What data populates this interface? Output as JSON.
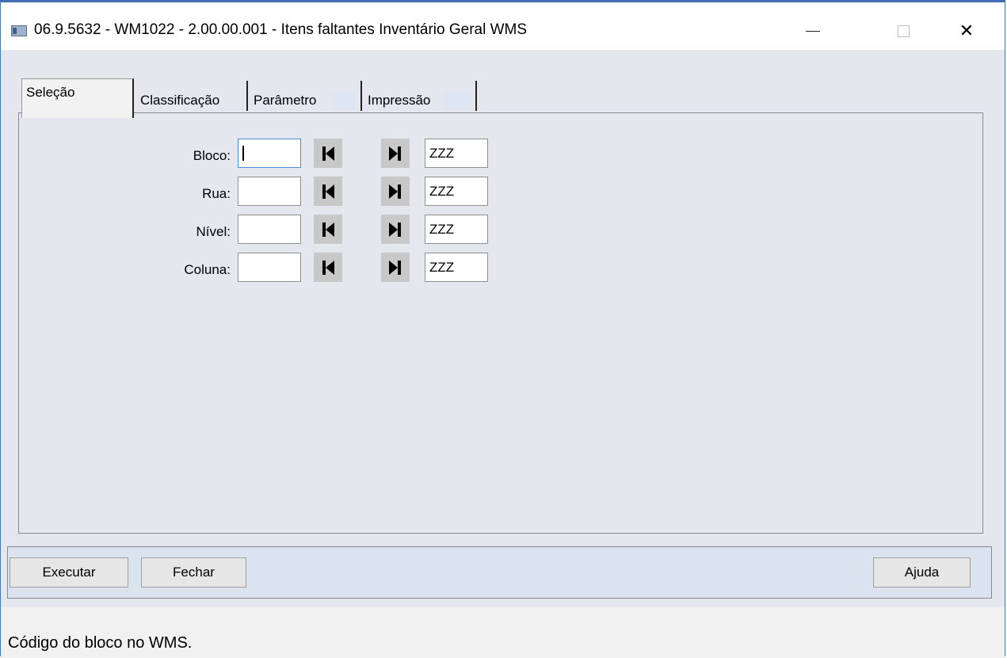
{
  "window": {
    "title": "06.9.5632 - WM1022 - 2.00.00.001 - Itens faltantes Inventário Geral WMS",
    "minimize_glyph": "—",
    "close_glyph": "✕"
  },
  "tabs": [
    {
      "label": "Seleção",
      "active": true
    },
    {
      "label": "Classificação",
      "active": false
    },
    {
      "label": "Parâmetro",
      "active": false
    },
    {
      "label": "Impressão",
      "active": false
    }
  ],
  "ranges": [
    {
      "label": "Bloco:",
      "from": "",
      "to": "ZZZ",
      "focused": true
    },
    {
      "label": "Rua:",
      "from": "",
      "to": "ZZZ",
      "focused": false
    },
    {
      "label": "Nível:",
      "from": "",
      "to": "ZZZ",
      "focused": false
    },
    {
      "label": "Coluna:",
      "from": "",
      "to": "ZZZ",
      "focused": false
    }
  ],
  "buttons": {
    "execute": "Executar",
    "close": "Fechar",
    "help": "Ajuda"
  },
  "icons": {
    "first": "first-record-icon",
    "last": "last-record-icon",
    "app": "app-window-icon"
  },
  "status": {
    "text": "Código do bloco no WMS."
  }
}
